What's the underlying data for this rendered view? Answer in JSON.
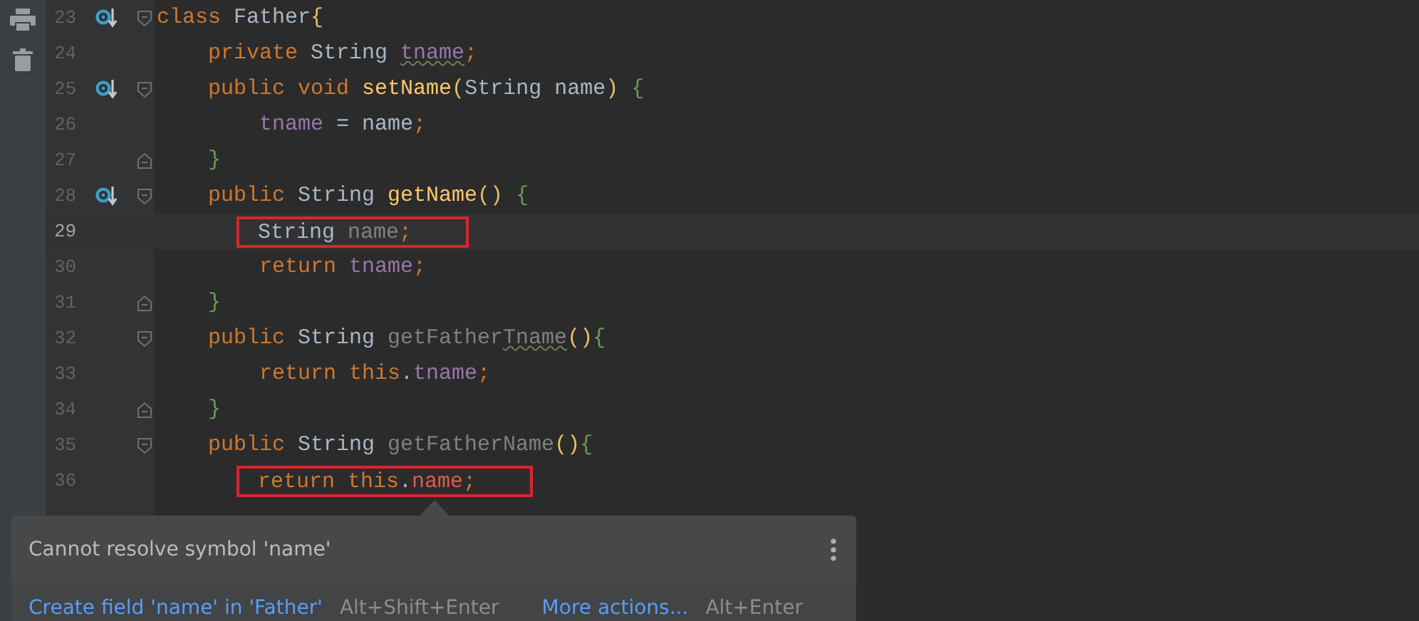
{
  "lines": [
    {
      "number": "23",
      "current": false,
      "override": true,
      "fold_open": true,
      "fold_close": false,
      "boxed": false,
      "tokens": [
        {
          "text": "class ",
          "kind": "keyword"
        },
        {
          "text": "Father",
          "kind": "plain"
        },
        {
          "text": "{",
          "kind": "paren"
        }
      ],
      "children": [
        {
          "number": "24",
          "current": false,
          "override": false,
          "fold_open": false,
          "fold_close": false,
          "boxed": false,
          "tokens": [
            {
              "text": "private ",
              "kind": "keyword"
            },
            {
              "text": "String ",
              "kind": "plain"
            },
            {
              "text": "tname",
              "kind": "field",
              "typo": true
            },
            {
              "text": ";",
              "kind": "keyword"
            }
          ]
        },
        {
          "number": "25",
          "current": false,
          "override": true,
          "fold_open": true,
          "fold_close": false,
          "boxed": false,
          "tokens": [
            {
              "text": "public void ",
              "kind": "keyword"
            },
            {
              "text": "setName",
              "kind": "method"
            },
            {
              "text": "(",
              "kind": "paren"
            },
            {
              "text": "String name",
              "kind": "plain"
            },
            {
              "text": ") ",
              "kind": "paren"
            },
            {
              "text": "{",
              "kind": "brace"
            }
          ],
          "children": [
            {
              "number": "26",
              "current": false,
              "override": false,
              "fold_open": false,
              "fold_close": false,
              "boxed": false,
              "tokens": [
                {
                  "text": "tname ",
                  "kind": "field"
                },
                {
                  "text": "= name",
                  "kind": "plain"
                },
                {
                  "text": ";",
                  "kind": "keyword"
                }
              ]
            }
          ]
        },
        {
          "number": "27",
          "current": false,
          "override": false,
          "fold_open": false,
          "fold_close": true,
          "boxed": false,
          "tokens": [
            {
              "text": "}",
              "kind": "brace"
            }
          ]
        },
        {
          "number": "28",
          "current": false,
          "override": true,
          "fold_open": true,
          "fold_close": false,
          "boxed": false,
          "tokens": [
            {
              "text": "public ",
              "kind": "keyword"
            },
            {
              "text": "String ",
              "kind": "plain"
            },
            {
              "text": "getName",
              "kind": "method"
            },
            {
              "text": "() ",
              "kind": "paren"
            },
            {
              "text": "{",
              "kind": "brace"
            }
          ],
          "children": [
            {
              "number": "29",
              "current": true,
              "override": false,
              "fold_open": false,
              "fold_close": false,
              "boxed": true,
              "tokens": [
                {
                  "text": "String ",
                  "kind": "plain"
                },
                {
                  "text": "name",
                  "kind": "unused"
                },
                {
                  "text": ";",
                  "kind": "keyword"
                }
              ]
            },
            {
              "number": "30",
              "current": false,
              "override": false,
              "fold_open": false,
              "fold_close": false,
              "boxed": false,
              "tokens": [
                {
                  "text": "return ",
                  "kind": "keyword"
                },
                {
                  "text": "tname",
                  "kind": "field"
                },
                {
                  "text": ";",
                  "kind": "keyword"
                }
              ]
            }
          ]
        },
        {
          "number": "31",
          "current": false,
          "override": false,
          "fold_open": false,
          "fold_close": true,
          "boxed": false,
          "tokens": [
            {
              "text": "}",
              "kind": "brace"
            }
          ]
        },
        {
          "number": "32",
          "current": false,
          "override": false,
          "fold_open": true,
          "fold_close": false,
          "boxed": false,
          "tokens": [
            {
              "text": "public ",
              "kind": "keyword"
            },
            {
              "text": "String ",
              "kind": "plain"
            },
            {
              "text": "getFather",
              "kind": "unused"
            },
            {
              "text": "Tname",
              "kind": "unused",
              "typo": true
            },
            {
              "text": "()",
              "kind": "paren"
            },
            {
              "text": "{",
              "kind": "brace"
            }
          ],
          "children": [
            {
              "number": "33",
              "current": false,
              "override": false,
              "fold_open": false,
              "fold_close": false,
              "boxed": false,
              "tokens": [
                {
                  "text": "return this",
                  "kind": "keyword"
                },
                {
                  "text": ".",
                  "kind": "plain"
                },
                {
                  "text": "tname",
                  "kind": "field"
                },
                {
                  "text": ";",
                  "kind": "keyword"
                }
              ]
            }
          ]
        },
        {
          "number": "34",
          "current": false,
          "override": false,
          "fold_open": false,
          "fold_close": true,
          "boxed": false,
          "tokens": [
            {
              "text": "}",
              "kind": "brace"
            }
          ]
        },
        {
          "number": "35",
          "current": false,
          "override": false,
          "fold_open": true,
          "fold_close": false,
          "boxed": false,
          "tokens": [
            {
              "text": "public ",
              "kind": "keyword"
            },
            {
              "text": "String ",
              "kind": "plain"
            },
            {
              "text": "getFatherName",
              "kind": "unused"
            },
            {
              "text": "()",
              "kind": "paren"
            },
            {
              "text": "{",
              "kind": "brace"
            }
          ],
          "children": [
            {
              "number": "36",
              "current": false,
              "override": false,
              "fold_open": false,
              "fold_close": false,
              "boxed": true,
              "tokens": [
                {
                  "text": "return this",
                  "kind": "keyword"
                },
                {
                  "text": ".",
                  "kind": "plain"
                },
                {
                  "text": "name",
                  "kind": "error"
                },
                {
                  "text": ";",
                  "kind": "keyword"
                }
              ]
            }
          ]
        }
      ]
    }
  ],
  "popup": {
    "message": "Cannot resolve symbol 'name'",
    "actions": [
      {
        "label": "Create field 'name' in 'Father'",
        "shortcut": "Alt+Shift+Enter"
      },
      {
        "label": "More actions...",
        "shortcut": "Alt+Enter"
      }
    ]
  }
}
